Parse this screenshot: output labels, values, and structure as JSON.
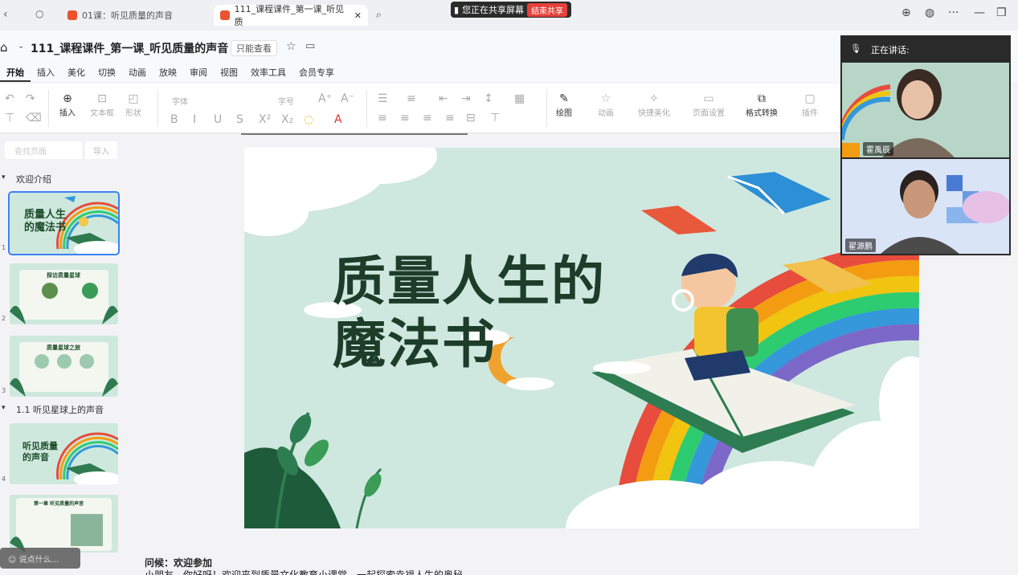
{
  "browser": {
    "tabs": [
      {
        "title": "01课：听见质量的声音",
        "active": false
      },
      {
        "title": "111_课程课件_第一课_听见质",
        "active": true
      }
    ],
    "share_bar": {
      "text": "您正在共享屏幕",
      "stop_label": "结束共享"
    }
  },
  "doc": {
    "title": "111_课程课件_第一课_听见质量的声音",
    "mode": "只能查看"
  },
  "menu": [
    "开始",
    "插入",
    "美化",
    "切换",
    "动画",
    "放映",
    "审阅",
    "视图",
    "效率工具",
    "会员专享"
  ],
  "ribbon": {
    "insert": "插入",
    "textbox": "文本框",
    "shape": "形状",
    "font": "字体",
    "fontsize": "字号",
    "draw": "绘图",
    "animation": "动画",
    "quick_beautify": "快捷美化",
    "page_setup": "页面设置",
    "format_convert": "格式转换",
    "plugins": "插件"
  },
  "left_panel": {
    "search_placeholder": "查找页面",
    "import": "导入",
    "sections": [
      "欢迎介绍",
      "1.1 听见星球上的声音"
    ],
    "thumbs": [
      {
        "title": "质量人生的魔法书",
        "num": "1"
      },
      {
        "title": "探访质量星球",
        "num": "2"
      },
      {
        "title": "质量星球之旅",
        "num": "3"
      },
      {
        "title": "听见质量的声音",
        "num": "4"
      },
      {
        "title": "第一章 听见质量的声音",
        "num": "5"
      }
    ],
    "comment_placeholder": "说点什么..."
  },
  "slide": {
    "title_line1": "质量人生的",
    "title_line2": "魔法书"
  },
  "notes": {
    "title": "问候：欢迎参加",
    "body": "小朋友，你好呀！欢迎来到质量文化教育小课堂，一起探索幸福人生的奥秘"
  },
  "meeting": {
    "header": "正在讲话:",
    "participants": [
      {
        "name": "霍禹辰"
      },
      {
        "name": "翟源鹏"
      }
    ]
  },
  "colors": {
    "slide_bg": "#cfe8df",
    "title_green": "#1d3d2a",
    "share_stop": "#e5413a",
    "selection": "#3b82f6"
  }
}
